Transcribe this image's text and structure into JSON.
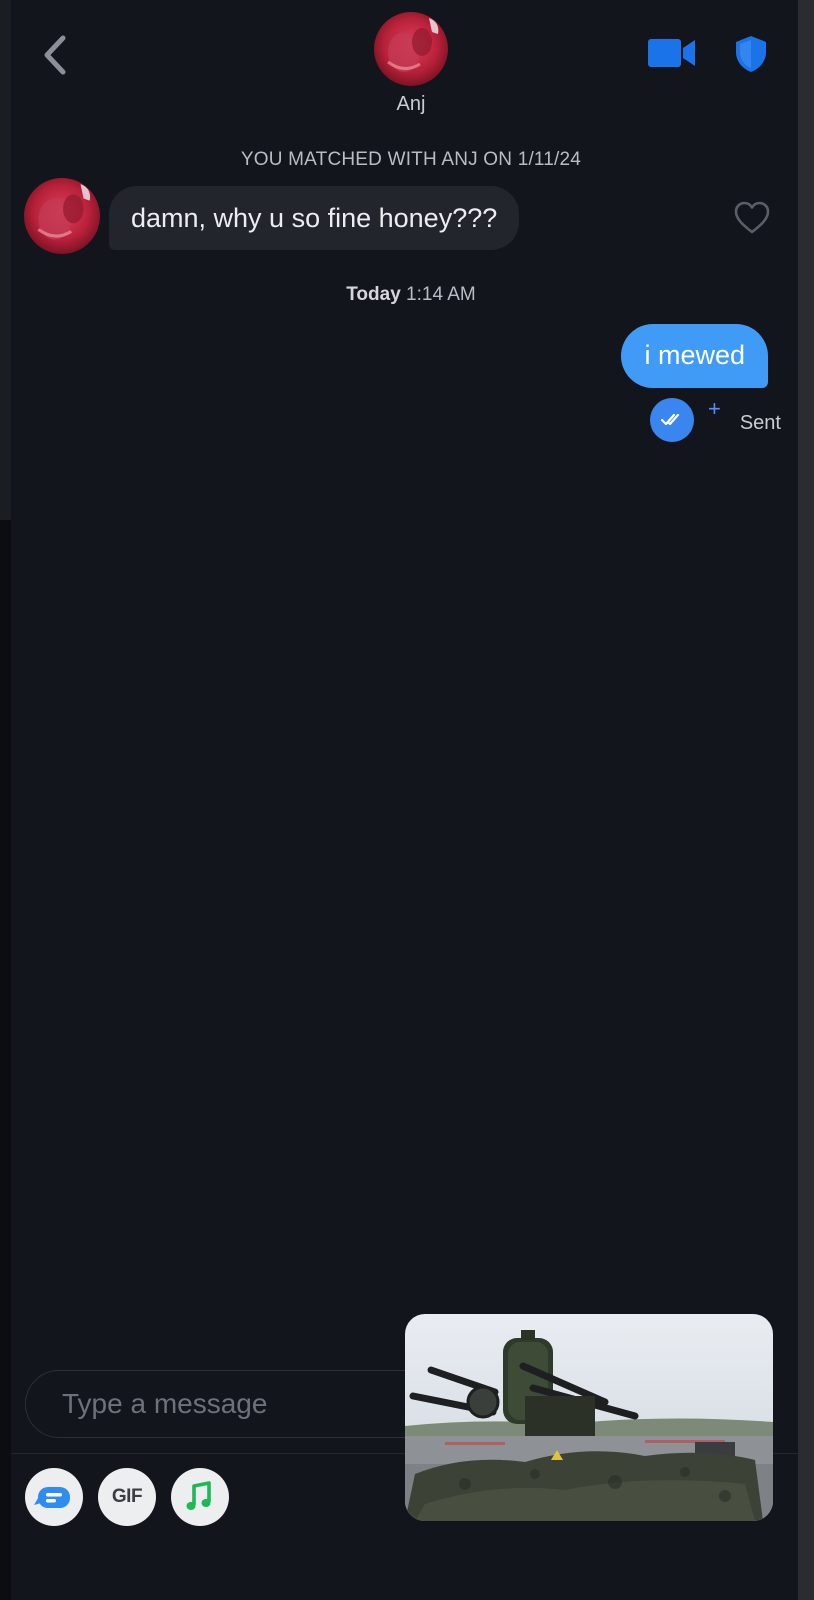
{
  "header": {
    "name": "Anj",
    "back_icon": "chevron-left-icon",
    "video_icon": "video-camera-icon",
    "safety_icon": "shield-icon"
  },
  "match_banner": "YOU MATCHED WITH ANJ ON 1/11/24",
  "messages": {
    "incoming": {
      "text": "damn, why u so fine honey???"
    },
    "timestamp_day": "Today",
    "timestamp_time": "1:14 AM",
    "outgoing": {
      "text": "i mewed",
      "plus": "+",
      "status": "Sent"
    }
  },
  "composer": {
    "placeholder": "Type a message",
    "tools": [
      {
        "icon": "sticker-chat-icon"
      },
      {
        "label": "GIF"
      },
      {
        "icon": "music-note-icon"
      }
    ]
  },
  "colors": {
    "accent_blue": "#3f9bf5",
    "header_icon_blue": "#1a73e8",
    "background": "#12151b"
  }
}
